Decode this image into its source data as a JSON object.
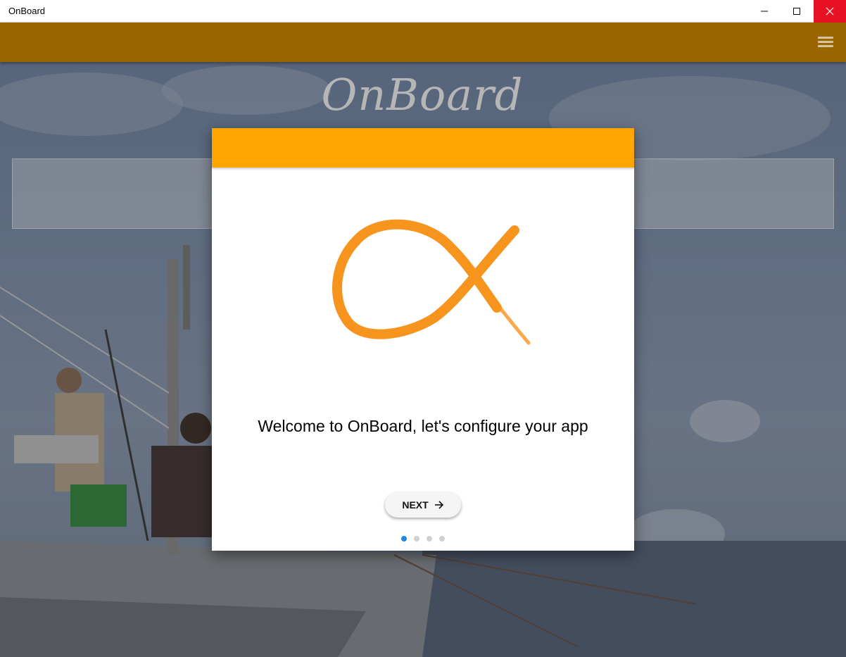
{
  "window": {
    "title": "OnBoard"
  },
  "app": {
    "logo_text": "OnBoard"
  },
  "dialog": {
    "welcome_text": "Welcome to OnBoard, let's configure your app",
    "next_label": "NEXT",
    "pagination": {
      "total": 4,
      "current": 1
    }
  },
  "icons": {
    "hamburger": "hamburger-menu-icon",
    "next_arrow": "arrow-right-icon",
    "logo": "fish-logo-icon"
  },
  "colors": {
    "appbar": "#996600",
    "dialog_header": "#ffa500",
    "logo": "#f7941d",
    "active_dot": "#1e88e5",
    "close_button": "#e81123"
  }
}
